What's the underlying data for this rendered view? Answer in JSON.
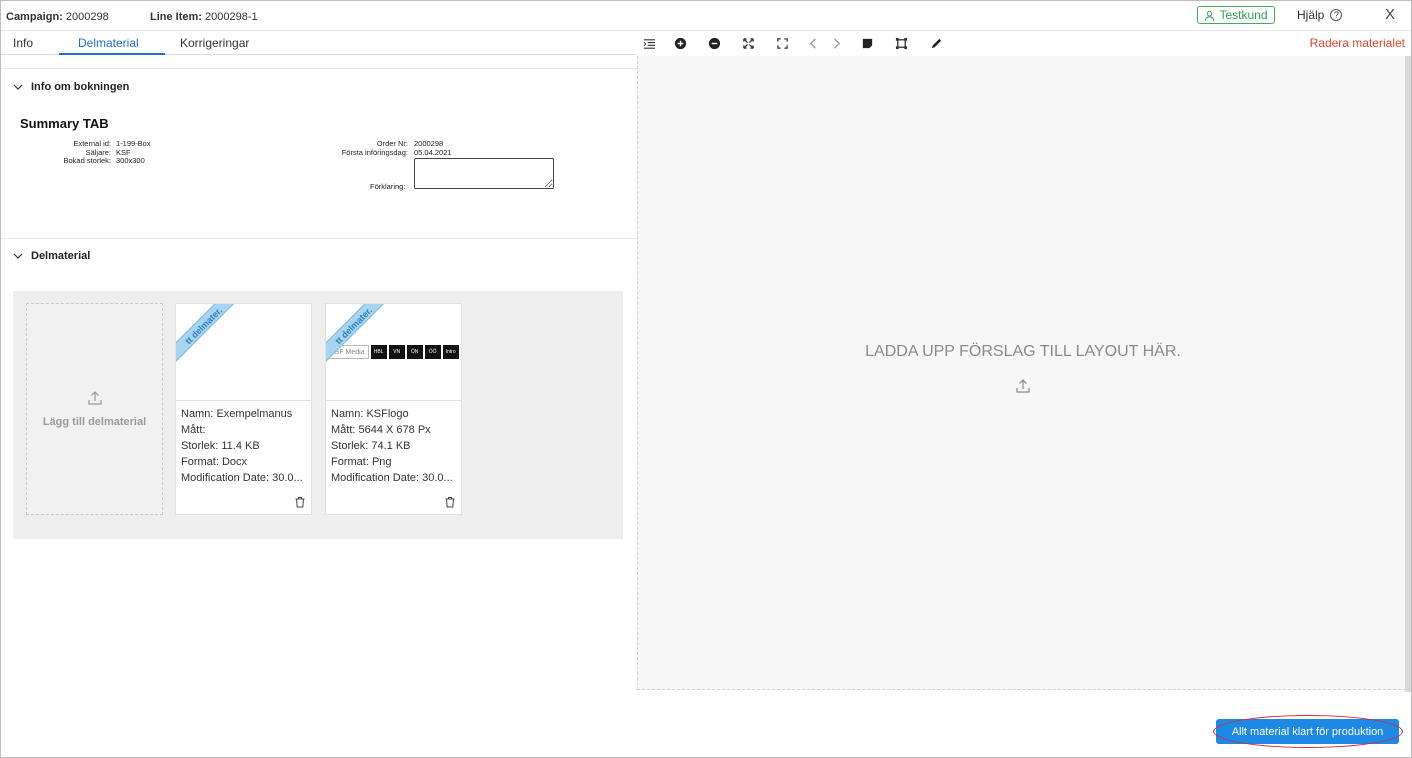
{
  "header": {
    "campaign_label": "Campaign:",
    "campaign_value": "2000298",
    "line_item_label": "Line Item:",
    "line_item_value": "2000298-1",
    "customer_badge": "Testkund",
    "help_label": "Hjälp",
    "close_glyph": "X"
  },
  "tabs": [
    {
      "label": "Info"
    },
    {
      "label": "Delmaterial"
    },
    {
      "label": "Korrigeringar"
    }
  ],
  "toolbar": {
    "delete_material": "Radera materialet",
    "tools": [
      "list-icon",
      "zoom-in-icon",
      "zoom-out-icon",
      "fit-icon",
      "fullscreen-icon",
      "prev-icon",
      "next-icon",
      "note-icon",
      "crop-icon",
      "pen-icon"
    ]
  },
  "booking": {
    "section_title": "Info om bokningen",
    "summary_title": "Summary TAB",
    "external_id_label": "External id:",
    "external_id_value": "1-199-Box",
    "seller_label": "Säljare:",
    "seller_value": "KSF",
    "booked_size_label": "Bokad storlek:",
    "booked_size_value": "300x300",
    "order_nr_label": "Order Nr:",
    "order_nr_value": "2000298",
    "first_insertion_label": "Första införingsdag:",
    "first_insertion_value": "05.04.2021",
    "explanation_label": "Förklaring:"
  },
  "delmaterial": {
    "section_title": "Delmaterial",
    "add_label": "Lägg till delmaterial",
    "items": [
      {
        "ribbon": "tt delmater.",
        "name": "Namn: Exempelmanus",
        "dims": "Mått:",
        "size": "Storlek: 11.4 KB",
        "format": "Format: Docx",
        "modified": "Modification Date: 30.0..."
      },
      {
        "ribbon": "tt delmater.",
        "logo_text": "KSF Media",
        "logos": [
          "HBL",
          "VN",
          "ÖN",
          "ÖÖ",
          "Intro"
        ],
        "name": "Namn: KSFlogo",
        "dims": "Mått: 5644 X 678 Px",
        "size": "Storlek: 74.1 KB",
        "format": "Format: Png",
        "modified": "Modification Date: 30.0..."
      }
    ]
  },
  "preview": {
    "upload_text": "LADDA UPP FÖRSLAG TILL LAYOUT HÄR."
  },
  "footer": {
    "ready_button": "Allt material klart för produktion"
  },
  "colors": {
    "accent": "#1d6fd6",
    "cta": "#1e88e5",
    "danger": "#e0442e",
    "success": "#2e9e4a",
    "ribbon": "#a8d4f0"
  }
}
